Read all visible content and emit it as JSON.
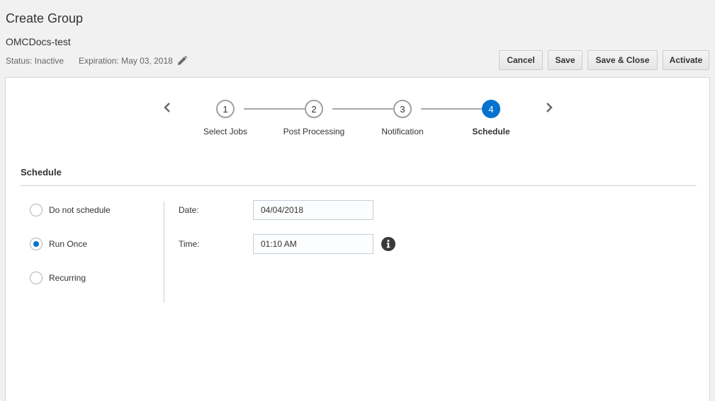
{
  "header": {
    "title": "Create Group",
    "group_name": "OMCDocs-test",
    "status": "Status: Inactive",
    "expiration": "Expiration: May 03, 2018",
    "edit_icon": "pencil-icon"
  },
  "toolbar": {
    "cancel_label": "Cancel",
    "save_label": "Save",
    "save_close_label": "Save & Close",
    "activate_label": "Activate"
  },
  "train": {
    "prev_icon": "chevron-left-icon",
    "next_icon": "chevron-right-icon",
    "steps": [
      {
        "number": "1",
        "label": "Select Jobs"
      },
      {
        "number": "2",
        "label": "Post Processing"
      },
      {
        "number": "3",
        "label": "Notification"
      },
      {
        "number": "4",
        "label": "Schedule"
      }
    ],
    "active_step": 4,
    "active_color": "#0572ce"
  },
  "schedule": {
    "section_title": "Schedule",
    "options": [
      {
        "label": "Do not schedule",
        "selected": false
      },
      {
        "label": "Run Once",
        "selected": true
      },
      {
        "label": "Recurring",
        "selected": false
      }
    ],
    "date_label": "Date:",
    "date_value": "04/04/2018",
    "time_label": "Time:",
    "time_value": "01:10 AM",
    "info_icon": "info-icon"
  }
}
